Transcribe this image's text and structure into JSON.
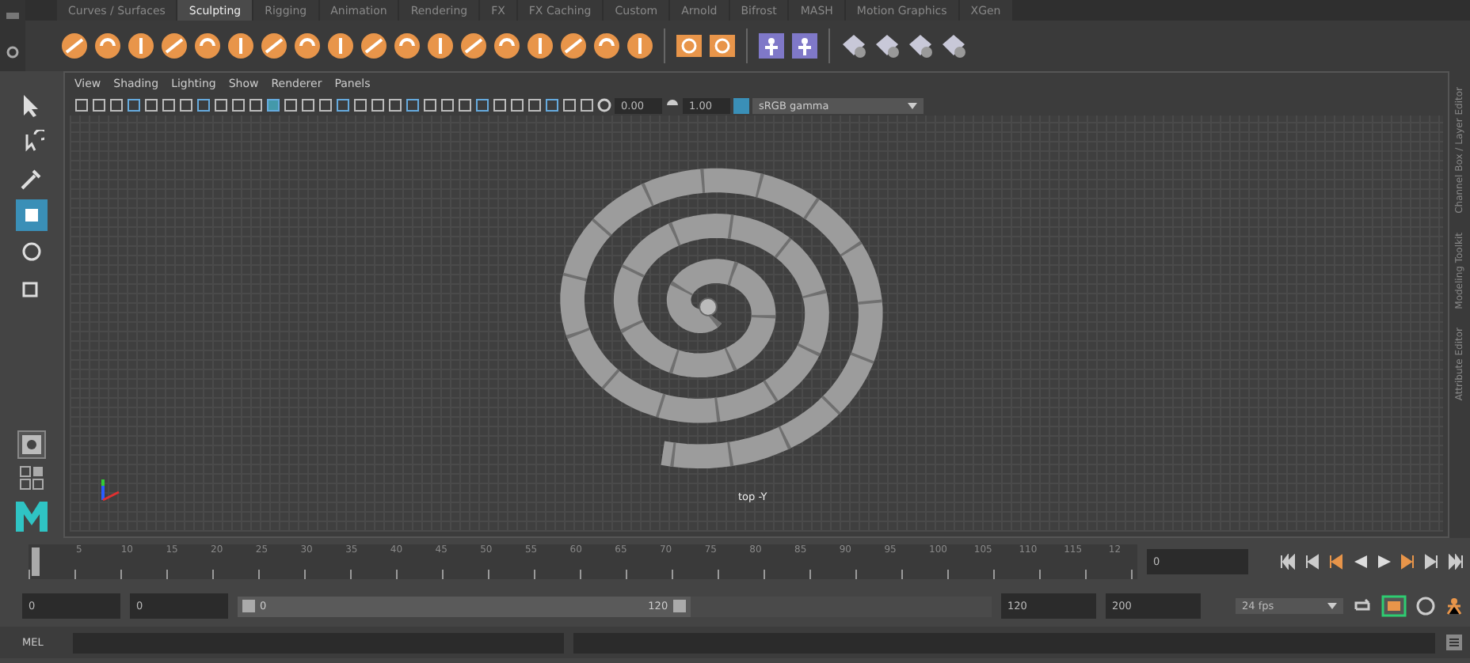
{
  "shelf": {
    "tabs": [
      {
        "label": "Curves / Surfaces",
        "selected": false
      },
      {
        "label": "Sculpting",
        "selected": true
      },
      {
        "label": "Rigging",
        "selected": false
      },
      {
        "label": "Animation",
        "selected": false
      },
      {
        "label": "Rendering",
        "selected": false
      },
      {
        "label": "FX",
        "selected": false
      },
      {
        "label": "FX Caching",
        "selected": false
      },
      {
        "label": "Custom",
        "selected": false
      },
      {
        "label": "Arnold",
        "selected": false
      },
      {
        "label": "Bifrost",
        "selected": false
      },
      {
        "label": "MASH",
        "selected": false
      },
      {
        "label": "Motion Graphics",
        "selected": false
      },
      {
        "label": "XGen",
        "selected": false
      }
    ]
  },
  "toolbox": {
    "tools": [
      {
        "kind": "select",
        "selected": false
      },
      {
        "kind": "lasso",
        "selected": false
      },
      {
        "kind": "paint",
        "selected": false
      },
      {
        "kind": "move",
        "selected": true
      },
      {
        "kind": "rotate",
        "selected": false
      },
      {
        "kind": "scale",
        "selected": false
      }
    ]
  },
  "viewport": {
    "menu": [
      "View",
      "Shading",
      "Lighting",
      "Show",
      "Renderer",
      "Panels"
    ],
    "exposure": "0.00",
    "gamma": "1.00",
    "color_space": "sRGB gamma",
    "camera_label": "top -Y"
  },
  "side_tabs": [
    "Channel Box / Layer Editor",
    "Modeling Toolkit",
    "Attribute Editor"
  ],
  "timeline": {
    "ticks": [
      "5",
      "10",
      "15",
      "20",
      "25",
      "30",
      "35",
      "40",
      "45",
      "50",
      "55",
      "60",
      "65",
      "70",
      "75",
      "80",
      "85",
      "90",
      "95",
      "100",
      "105",
      "110",
      "115",
      "12"
    ],
    "current_frame": "0",
    "level": 0
  },
  "range": {
    "start": "0",
    "playback_start": "0",
    "slider_start": "0",
    "slider_end": "120",
    "playback_end": "120",
    "end": "200",
    "fps": "24 fps",
    "level": 0.6
  },
  "command_line": {
    "label": "MEL"
  }
}
